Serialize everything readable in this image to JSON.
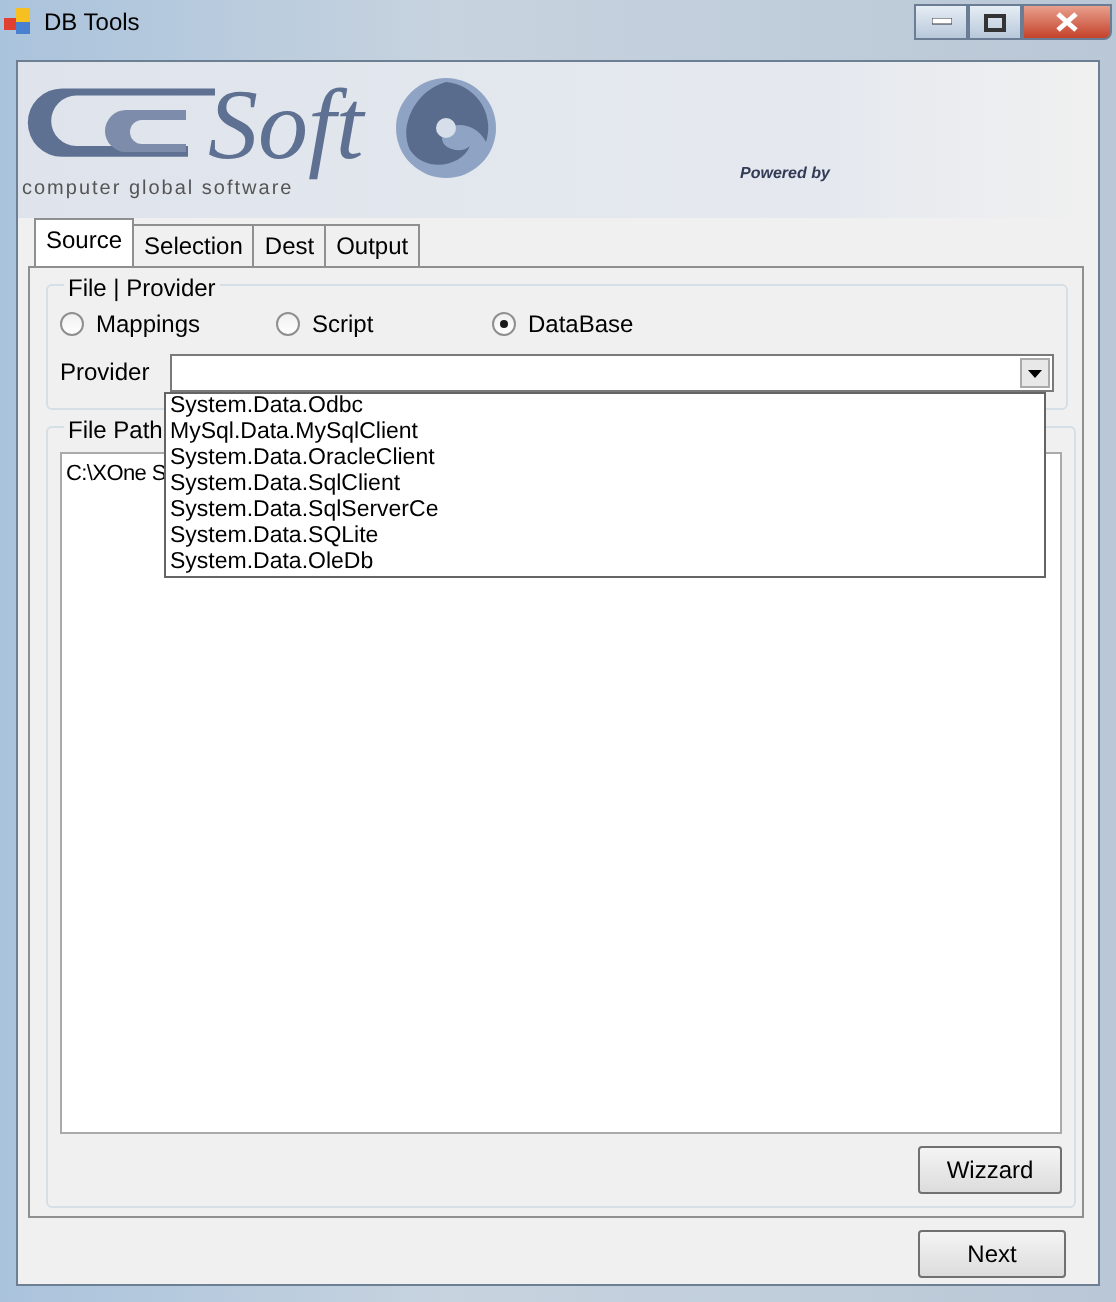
{
  "window": {
    "title": "DB Tools"
  },
  "logo": {
    "brand": "Soft",
    "tagline": "computer global software",
    "powered": "Powered by"
  },
  "tabs": [
    {
      "label": "Source",
      "selected": true
    },
    {
      "label": "Selection",
      "selected": false
    },
    {
      "label": "Dest",
      "selected": false
    },
    {
      "label": "Output",
      "selected": false
    }
  ],
  "file_provider": {
    "title": "File | Provider",
    "options": [
      {
        "label": "Mappings",
        "selected": false
      },
      {
        "label": "Script",
        "selected": false
      },
      {
        "label": "DataBase",
        "selected": true
      }
    ],
    "provider_label": "Provider",
    "provider_options": [
      "System.Data.Odbc",
      "MySql.Data.MySqlClient",
      "System.Data.OracleClient",
      "System.Data.SqlClient",
      "System.Data.SqlServerCe",
      "System.Data.SQLite",
      "System.Data.OleDb"
    ]
  },
  "file_path": {
    "title": "File Path",
    "value": "C:\\XOne S"
  },
  "buttons": {
    "wizard": "Wizzard",
    "next": "Next"
  }
}
